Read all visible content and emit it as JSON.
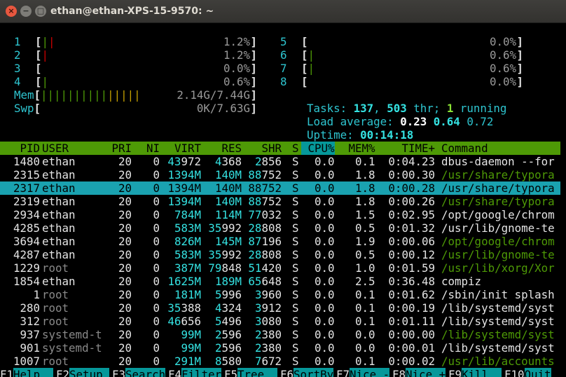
{
  "window": {
    "title": "ethan@ethan-XPS-15-9570: ~",
    "buttons": {
      "close": "×",
      "minimize": "−",
      "maximize": "□"
    }
  },
  "cpus": [
    {
      "num": "1",
      "bar": [
        {
          "ch": "|",
          "c": "green"
        },
        {
          "ch": "|",
          "c": "red"
        }
      ],
      "pct": "1.2%"
    },
    {
      "num": "2",
      "bar": [
        {
          "ch": "|",
          "c": "red"
        }
      ],
      "pct": "1.2%"
    },
    {
      "num": "3",
      "bar": [],
      "pct": "0.0%"
    },
    {
      "num": "4",
      "bar": [
        {
          "ch": "|",
          "c": "green"
        }
      ],
      "pct": "0.6%"
    },
    {
      "num": "5",
      "bar": [],
      "pct": "0.0%"
    },
    {
      "num": "6",
      "bar": [
        {
          "ch": "|",
          "c": "green"
        }
      ],
      "pct": "0.6%"
    },
    {
      "num": "7",
      "bar": [
        {
          "ch": "|",
          "c": "green"
        }
      ],
      "pct": "0.6%"
    },
    {
      "num": "8",
      "bar": [],
      "pct": "0.0%"
    }
  ],
  "mem": {
    "label": "Mem",
    "bar_green": "||||||||||",
    "bar_yellow": "|||||",
    "value": "2.14G/7.44G"
  },
  "swp": {
    "label": "Swp",
    "value": "0K/7.63G"
  },
  "tasks": {
    "label": "Tasks: ",
    "count": "137",
    "sep": ", ",
    "threads": "503",
    "thr_label": " thr; ",
    "running": "1",
    "run_label": " running"
  },
  "load": {
    "label": "Load average: ",
    "l1": "0.23",
    "l5": "0.64",
    "l15": "0.72"
  },
  "uptime": {
    "label": "Uptime: ",
    "value": "00:14:18"
  },
  "header": [
    "PID",
    "USER",
    "PRI",
    "NI",
    "VIRT",
    "RES",
    "SHR",
    "S",
    "CPU%",
    "MEM%",
    "TIME+",
    "Command"
  ],
  "sort_column": "CPU%",
  "processes": [
    {
      "pid": "1480",
      "user": "ethan",
      "pri": "20",
      "ni": "0",
      "virt": [
        "43",
        "972"
      ],
      "res": [
        "4",
        "368"
      ],
      "shr": [
        "2",
        "856"
      ],
      "s": "S",
      "cpu": "0.0",
      "mem": "0.1",
      "time": "0:04.23",
      "cmd": "dbus-daemon --for",
      "cmd_green": false
    },
    {
      "pid": "2315",
      "user": "ethan",
      "pri": "20",
      "ni": "0",
      "virt": [
        "1394M",
        ""
      ],
      "res": [
        "140M",
        ""
      ],
      "shr": [
        "88",
        "752"
      ],
      "s": "S",
      "cpu": "0.0",
      "mem": "1.8",
      "time": "0:00.30",
      "cmd": "/usr/share/typora",
      "cmd_green": true
    },
    {
      "pid": "2317",
      "user": "ethan",
      "pri": "20",
      "ni": "0",
      "virt": [
        "1394M",
        ""
      ],
      "res": [
        "140M",
        ""
      ],
      "shr": [
        "88",
        "752"
      ],
      "s": "S",
      "cpu": "0.0",
      "mem": "1.8",
      "time": "0:00.28",
      "cmd": "/usr/share/typora",
      "cmd_green": false,
      "selected": true
    },
    {
      "pid": "2319",
      "user": "ethan",
      "pri": "20",
      "ni": "0",
      "virt": [
        "1394M",
        ""
      ],
      "res": [
        "140M",
        ""
      ],
      "shr": [
        "88",
        "752"
      ],
      "s": "S",
      "cpu": "0.0",
      "mem": "1.8",
      "time": "0:00.26",
      "cmd": "/usr/share/typora",
      "cmd_green": true
    },
    {
      "pid": "2934",
      "user": "ethan",
      "pri": "20",
      "ni": "0",
      "virt": [
        "784M",
        ""
      ],
      "res": [
        "114M",
        ""
      ],
      "shr": [
        "77",
        "032"
      ],
      "s": "S",
      "cpu": "0.0",
      "mem": "1.5",
      "time": "0:02.95",
      "cmd": "/opt/google/chrom",
      "cmd_green": false
    },
    {
      "pid": "4285",
      "user": "ethan",
      "pri": "20",
      "ni": "0",
      "virt": [
        "583M",
        ""
      ],
      "res": [
        "35",
        "992"
      ],
      "shr": [
        "28",
        "808"
      ],
      "s": "S",
      "cpu": "0.0",
      "mem": "0.5",
      "time": "0:01.32",
      "cmd": "/usr/lib/gnome-te",
      "cmd_green": false
    },
    {
      "pid": "3694",
      "user": "ethan",
      "pri": "20",
      "ni": "0",
      "virt": [
        "826M",
        ""
      ],
      "res": [
        "145M",
        ""
      ],
      "shr": [
        "87",
        "196"
      ],
      "s": "S",
      "cpu": "0.0",
      "mem": "1.9",
      "time": "0:00.06",
      "cmd": "/opt/google/chrom",
      "cmd_green": true
    },
    {
      "pid": "4287",
      "user": "ethan",
      "pri": "20",
      "ni": "0",
      "virt": [
        "583M",
        ""
      ],
      "res": [
        "35",
        "992"
      ],
      "shr": [
        "28",
        "808"
      ],
      "s": "S",
      "cpu": "0.0",
      "mem": "0.5",
      "time": "0:00.12",
      "cmd": "/usr/lib/gnome-te",
      "cmd_green": true
    },
    {
      "pid": "1229",
      "user": "root",
      "pri": "20",
      "ni": "0",
      "virt": [
        "387M",
        ""
      ],
      "res": [
        "79",
        "848"
      ],
      "shr": [
        "51",
        "420"
      ],
      "s": "S",
      "cpu": "0.0",
      "mem": "1.0",
      "time": "0:01.59",
      "cmd": "/usr/lib/xorg/Xor",
      "cmd_green": true,
      "user_dim": true
    },
    {
      "pid": "1854",
      "user": "ethan",
      "pri": "20",
      "ni": "0",
      "virt": [
        "1625M",
        ""
      ],
      "res": [
        "189M",
        ""
      ],
      "shr": [
        "65",
        "648"
      ],
      "s": "S",
      "cpu": "0.0",
      "mem": "2.5",
      "time": "0:36.48",
      "cmd": "compiz",
      "cmd_green": false
    },
    {
      "pid": "1",
      "user": "root",
      "pri": "20",
      "ni": "0",
      "virt": [
        "181M",
        ""
      ],
      "res": [
        "5",
        "996"
      ],
      "shr": [
        "3",
        "960"
      ],
      "s": "S",
      "cpu": "0.0",
      "mem": "0.1",
      "time": "0:01.62",
      "cmd": "/sbin/init splash",
      "cmd_green": false,
      "user_dim": true
    },
    {
      "pid": "280",
      "user": "root",
      "pri": "20",
      "ni": "0",
      "virt": [
        "35",
        "388"
      ],
      "res": [
        "4",
        "324"
      ],
      "shr": [
        "3",
        "912"
      ],
      "s": "S",
      "cpu": "0.0",
      "mem": "0.1",
      "time": "0:00.19",
      "cmd": "/lib/systemd/syst",
      "cmd_green": false,
      "user_dim": true
    },
    {
      "pid": "312",
      "user": "root",
      "pri": "20",
      "ni": "0",
      "virt": [
        "46",
        "656"
      ],
      "res": [
        "5",
        "496"
      ],
      "shr": [
        "3",
        "080"
      ],
      "s": "S",
      "cpu": "0.0",
      "mem": "0.1",
      "time": "0:01.11",
      "cmd": "/lib/systemd/syst",
      "cmd_green": false,
      "user_dim": true
    },
    {
      "pid": "937",
      "user": "systemd-t",
      "pri": "20",
      "ni": "0",
      "virt": [
        "99M",
        ""
      ],
      "res": [
        "2",
        "596"
      ],
      "shr": [
        "2",
        "380"
      ],
      "s": "S",
      "cpu": "0.0",
      "mem": "0.0",
      "time": "0:00.00",
      "cmd": "/lib/systemd/syst",
      "cmd_green": true,
      "user_dim": true
    },
    {
      "pid": "901",
      "user": "systemd-t",
      "pri": "20",
      "ni": "0",
      "virt": [
        "99M",
        ""
      ],
      "res": [
        "2",
        "596"
      ],
      "shr": [
        "2",
        "380"
      ],
      "s": "S",
      "cpu": "0.0",
      "mem": "0.0",
      "time": "0:00.01",
      "cmd": "/lib/systemd/syst",
      "cmd_green": false,
      "user_dim": true
    },
    {
      "pid": "1007",
      "user": "root",
      "pri": "20",
      "ni": "0",
      "virt": [
        "291M",
        ""
      ],
      "res": [
        "8",
        "580"
      ],
      "shr": [
        "7",
        "672"
      ],
      "s": "S",
      "cpu": "0.0",
      "mem": "0.1",
      "time": "0:00.02",
      "cmd": "/usr/lib/accounts",
      "cmd_green": true,
      "user_dim": true
    }
  ],
  "function_keys": [
    {
      "key": "F1",
      "label": "Help  "
    },
    {
      "key": "F2",
      "label": "Setup "
    },
    {
      "key": "F3",
      "label": "Search"
    },
    {
      "key": "F4",
      "label": "Filter"
    },
    {
      "key": "F5",
      "label": "Tree  "
    },
    {
      "key": "F6",
      "label": "SortBy"
    },
    {
      "key": "F7",
      "label": "Nice -"
    },
    {
      "key": "F8",
      "label": "Nice +"
    },
    {
      "key": "F9",
      "label": "Kill  "
    },
    {
      "key": "F10",
      "label": "Quit"
    }
  ],
  "colors": {
    "header_bg": "#4e9a06",
    "select_bg": "#1aa2b0",
    "fkey_bg": "#06989a",
    "cyan": "#34e2e2",
    "title_bar": "#3c3b37"
  }
}
